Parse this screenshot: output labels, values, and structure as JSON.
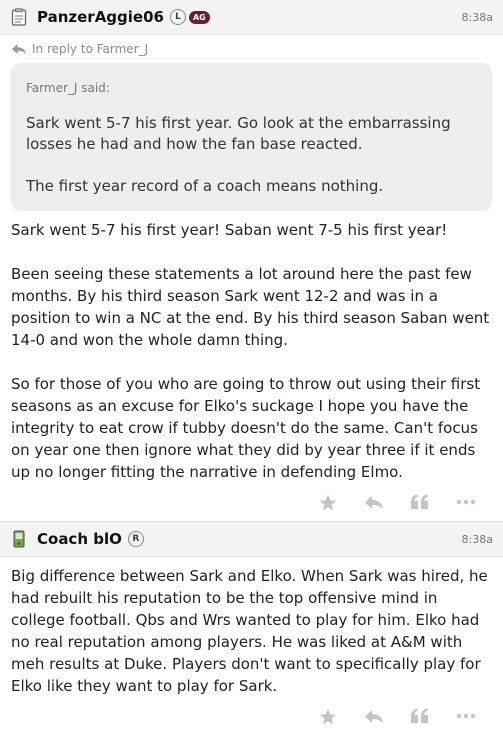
{
  "post1": {
    "username": "PanzerAggie06",
    "badge_l": "L",
    "badge_ag": "AG",
    "time": "8:38a",
    "reply_to": "In reply to Farmer_J",
    "quote": {
      "author": "Farmer_J said:",
      "paragraphs": [
        "Sark went 5-7 his first year. Go look at the embarrassing losses he had and how the fan base reacted.",
        "The first year record of a coach means nothing."
      ]
    },
    "paragraphs": [
      "Sark went 5-7 his first year! Saban went 7-5 his first year!",
      "Been seeing these statements a lot around here the past few months. By his third season Sark went 12-2 and was in a position to win a NC at the end. By his third season Saban went 14-0 and won the whole damn thing.",
      "So for those of you who are going to throw out using their first seasons as an excuse for Elko's suckage I hope you have the integrity to eat crow if tubby doesn't do the same. Can't focus on year one then ignore what they did by year three if it ends up no longer fitting the narrative in defending Elmo."
    ]
  },
  "post2": {
    "username": "Coach blO",
    "badge_r": "R",
    "time": "8:38a",
    "paragraphs": [
      "Big difference between Sark and Elko. When Sark was hired, he had rebuilt his reputation to be the top offensive mind in college football. Qbs and Wrs wanted to play for him. Elko had no real reputation among players. He was liked at A&M with meh results at Duke. Players don't want to specifically play for Elko like they want to play for Sark."
    ]
  },
  "icons": {
    "post1_header": "notepad-icon",
    "post2_header": "phone-icon",
    "reply_arrow": "reply-arrow-icon",
    "star": "star-icon",
    "reply": "reply-icon",
    "quote": "quote-icon",
    "more": "more-icon"
  },
  "colors": {
    "header_bg": "#f3f3f3",
    "quote_bg": "#eeeeee",
    "badge_ag_bg": "#6b1e2e",
    "icon_gray": "#c4c4c4"
  }
}
